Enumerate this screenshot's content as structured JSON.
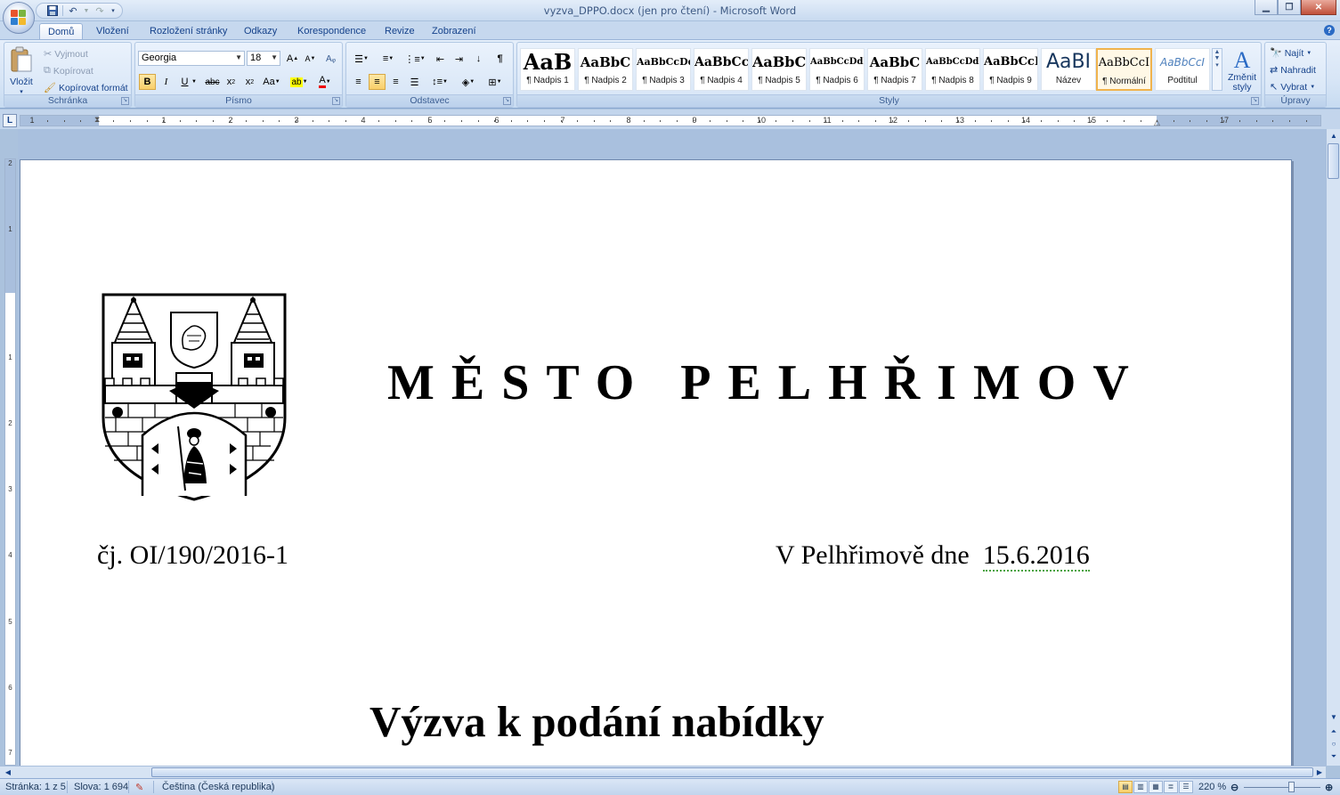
{
  "window": {
    "title": "vyzva_DPPO.docx (jen pro čtení) - Microsoft Word"
  },
  "tabs": [
    {
      "label": "Domů",
      "active": true
    },
    {
      "label": "Vložení"
    },
    {
      "label": "Rozložení stránky"
    },
    {
      "label": "Odkazy"
    },
    {
      "label": "Korespondence"
    },
    {
      "label": "Revize"
    },
    {
      "label": "Zobrazení"
    }
  ],
  "clipboard": {
    "paste": "Vložit",
    "cut": "Vyjmout",
    "copy": "Kopírovat",
    "format_painter": "Kopírovat formát",
    "group_label": "Schránka"
  },
  "font": {
    "name": "Georgia",
    "size": "18",
    "group_label": "Písmo"
  },
  "paragraph": {
    "group_label": "Odstavec"
  },
  "styles": {
    "group_label": "Styly",
    "items": [
      {
        "sample": "AaB",
        "name": "¶ Nadpis 1"
      },
      {
        "sample": "AaBbC",
        "name": "¶ Nadpis 2"
      },
      {
        "sample": "AaBbCcDd",
        "name": "¶ Nadpis 3"
      },
      {
        "sample": "AaBbCcI",
        "name": "¶ Nadpis 4"
      },
      {
        "sample": "AaBbC",
        "name": "¶ Nadpis 5"
      },
      {
        "sample": "AaBbCcDdI",
        "name": "¶ Nadpis 6"
      },
      {
        "sample": "AaBbC",
        "name": "¶ Nadpis 7"
      },
      {
        "sample": "AaBbCcDdI",
        "name": "¶ Nadpis 8"
      },
      {
        "sample": "AaBbCcI",
        "name": "¶ Nadpis 9"
      },
      {
        "sample": "AaBI",
        "name": "Název"
      },
      {
        "sample": "AaBbCcI",
        "name": "¶ Normální",
        "selected": true
      },
      {
        "sample": "AaBbCcI",
        "name": "Podtitul"
      }
    ],
    "change_styles": "Změnit styly"
  },
  "editing": {
    "find": "Najít",
    "replace": "Nahradit",
    "select": "Vybrat",
    "group_label": "Úpravy"
  },
  "ruler": {
    "corner": "L",
    "numbers": [
      "1",
      "1",
      "2",
      "3",
      "4",
      "5",
      "6",
      "7",
      "8",
      "9",
      "10",
      "11",
      "12",
      "13",
      "14",
      "15",
      "17"
    ],
    "vnumbers": [
      "2",
      "1",
      "1",
      "2",
      "3",
      "4",
      "5",
      "6",
      "7"
    ]
  },
  "document": {
    "city": "MĚSTO PELHŘIMOV",
    "ref_no": "čj. OI/190/2016-1",
    "date_prefix": "V Pelhřimově  dne",
    "date": "15.6.2016",
    "heading": "Výzva k podání nabídky"
  },
  "status": {
    "page": "Stránka: 1 z 5",
    "words": "Slova: 1 694",
    "language": "Čeština (Česká republika)",
    "zoom": "220 %"
  }
}
